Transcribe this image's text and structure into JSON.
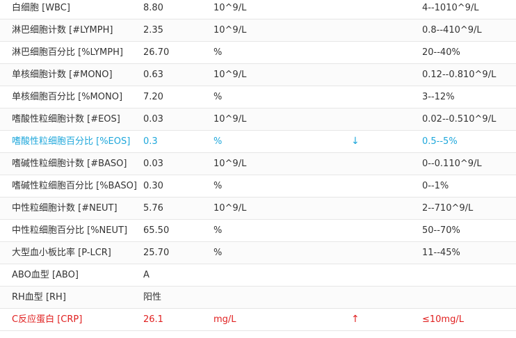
{
  "rows": [
    {
      "name": "白细胞 [WBC]",
      "value": "8.80",
      "unit": "10^9/L",
      "flag": "",
      "range": "4--1010^9/L",
      "status": "normal"
    },
    {
      "name": "淋巴细胞计数 [#LYMPH]",
      "value": "2.35",
      "unit": "10^9/L",
      "flag": "",
      "range": "0.8--410^9/L",
      "status": "normal"
    },
    {
      "name": "淋巴细胞百分比 [%LYMPH]",
      "value": "26.70",
      "unit": "%",
      "flag": "",
      "range": "20--40%",
      "status": "normal"
    },
    {
      "name": "单核细胞计数 [#MONO]",
      "value": "0.63",
      "unit": "10^9/L",
      "flag": "",
      "range": "0.12--0.810^9/L",
      "status": "normal"
    },
    {
      "name": "单核细胞百分比 [%MONO]",
      "value": "7.20",
      "unit": "%",
      "flag": "",
      "range": "3--12%",
      "status": "normal"
    },
    {
      "name": "嗜酸性粒细胞计数 [#EOS]",
      "value": "0.03",
      "unit": "10^9/L",
      "flag": "",
      "range": "0.02--0.510^9/L",
      "status": "normal"
    },
    {
      "name": "嗜酸性粒细胞百分比 [%EOS]",
      "value": "0.3",
      "unit": "%",
      "flag": "↓",
      "range": "0.5--5%",
      "status": "low"
    },
    {
      "name": "嗜碱性粒细胞计数 [#BASO]",
      "value": "0.03",
      "unit": "10^9/L",
      "flag": "",
      "range": "0--0.110^9/L",
      "status": "normal"
    },
    {
      "name": "嗜碱性粒细胞百分比 [%BASO]",
      "value": "0.30",
      "unit": "%",
      "flag": "",
      "range": "0--1%",
      "status": "normal"
    },
    {
      "name": "中性粒细胞计数 [#NEUT]",
      "value": "5.76",
      "unit": "10^9/L",
      "flag": "",
      "range": "2--710^9/L",
      "status": "normal"
    },
    {
      "name": "中性粒细胞百分比 [%NEUT]",
      "value": "65.50",
      "unit": "%",
      "flag": "",
      "range": "50--70%",
      "status": "normal"
    },
    {
      "name": "大型血小板比率 [P-LCR]",
      "value": "25.70",
      "unit": "%",
      "flag": "",
      "range": "11--45%",
      "status": "normal"
    },
    {
      "name": "ABO血型 [ABO]",
      "value": "A",
      "unit": "",
      "flag": "",
      "range": "",
      "status": "normal"
    },
    {
      "name": "RH血型 [RH]",
      "value": "阳性",
      "unit": "",
      "flag": "",
      "range": "",
      "status": "normal"
    },
    {
      "name": "C反应蛋白 [CRP]",
      "value": "26.1",
      "unit": "mg/L",
      "flag": "↑",
      "range": "≤10mg/L",
      "status": "high"
    }
  ],
  "colors": {
    "low": "#1ea7db",
    "high": "#e02020",
    "text": "#333333",
    "divider": "#e6e6e6"
  }
}
